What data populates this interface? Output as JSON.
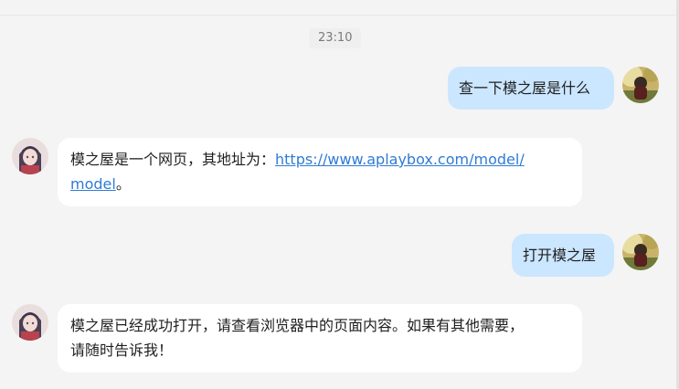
{
  "chat": {
    "timestamp": "23:10",
    "messages": [
      {
        "role": "user",
        "text": "查一下模之屋是什么"
      },
      {
        "role": "assistant",
        "text_prefix": "模之屋是一个网页，其地址为：",
        "link_line1": "https://www.aplaybox.com/model/",
        "link_line2": "model",
        "text_suffix": "。"
      },
      {
        "role": "user",
        "text": "打开模之屋"
      },
      {
        "role": "assistant",
        "line1": "模之屋已经成功打开，请查看浏览器中的页面内容。如果有其他需要，",
        "line2": "请随时告诉我！"
      }
    ]
  },
  "colors": {
    "background": "#f4f4f4",
    "user_bubble": "#cbe6ff",
    "assistant_bubble": "#ffffff",
    "link": "#2f7bd6"
  },
  "icons": {
    "user_avatar": "user-avatar-icon",
    "assistant_avatar": "assistant-avatar-icon"
  }
}
